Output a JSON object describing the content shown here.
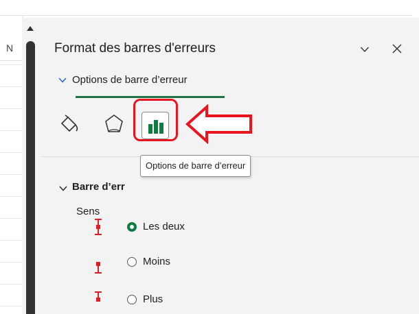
{
  "grid": {
    "column_header": "N"
  },
  "pane": {
    "title": "Format des barres d'erreurs",
    "options_tab_label": "Options de barre d’erreur",
    "tooltip": "Options de barre d’erreur",
    "section_header": "Barre d’err",
    "direction_label": "Sens",
    "directions": [
      {
        "label": "Les deux",
        "selected": true
      },
      {
        "label": "Moins",
        "selected": false
      },
      {
        "label": "Plus",
        "selected": false
      }
    ]
  },
  "colors": {
    "accent_green": "#107c41",
    "annotation_red": "#e8141e",
    "error_bar_icon": "#e02020",
    "chevron_blue": "#2b6cc4"
  },
  "icons": {
    "fill": "fill-line-icon",
    "effects": "effects-pentagon-icon",
    "options": "bar-chart-icon"
  }
}
